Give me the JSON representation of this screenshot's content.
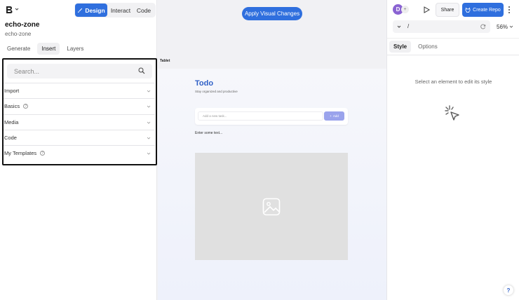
{
  "header": {
    "modes": [
      {
        "label": "Design",
        "active": true
      },
      {
        "label": "Interact",
        "active": false
      },
      {
        "label": "Code",
        "active": false
      }
    ]
  },
  "project": {
    "title": "echo-zone",
    "subtitle": "echo-zone"
  },
  "left_tabs": [
    {
      "label": "Generate",
      "active": false
    },
    {
      "label": "Insert",
      "active": true
    },
    {
      "label": "Layers",
      "active": false
    }
  ],
  "insert": {
    "search_placeholder": "Search...",
    "sections": [
      {
        "label": "Import",
        "has_info": false
      },
      {
        "label": "Basics",
        "has_info": true
      },
      {
        "label": "Media",
        "has_info": false
      },
      {
        "label": "Code",
        "has_info": false
      },
      {
        "label": "My Templates",
        "has_info": true
      }
    ]
  },
  "canvas": {
    "apply_label": "Apply Visual Changes",
    "device_label": "Tablet",
    "preview": {
      "title": "Todo",
      "subtitle": "Stay organized and productive",
      "task_placeholder": "Add a new task...",
      "add_label": "Add",
      "enter_text": "Enter some text..."
    }
  },
  "right": {
    "avatar_initial": "D",
    "share_label": "Share",
    "create_repo_label": "Create Repo",
    "url_path": "/",
    "zoom": "56%",
    "tabs": [
      {
        "label": "Style",
        "active": true
      },
      {
        "label": "Options",
        "active": false
      }
    ],
    "hint": "Select an element to edit its style",
    "help_label": "?"
  },
  "colors": {
    "accent": "#2f6fde",
    "title_blue": "#2f5fc6",
    "add_button": "#9aa3ec"
  }
}
